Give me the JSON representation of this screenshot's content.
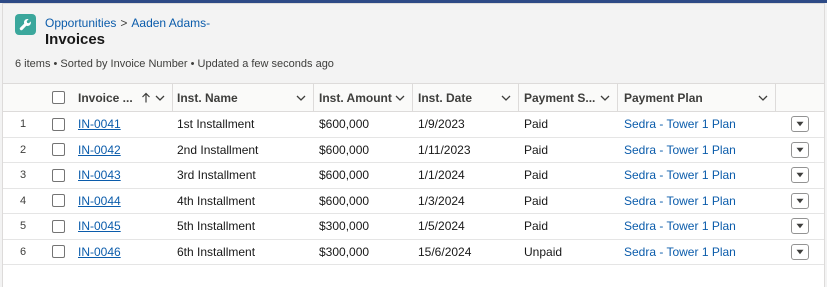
{
  "header": {
    "breadcrumb": [
      "Opportunities",
      "Aaden Adams-"
    ],
    "breadcrumb_separator": ">",
    "title": "Invoices",
    "status": "6 items • Sorted by Invoice Number • Updated a few seconds ago",
    "app_icon": "wrench-icon"
  },
  "table": {
    "columns": [
      {
        "label": "Invoice ...",
        "sorted": "ascending"
      },
      {
        "label": "Inst. Name"
      },
      {
        "label": "Inst. Amount"
      },
      {
        "label": "Inst. Date"
      },
      {
        "label": "Payment S..."
      },
      {
        "label": "Payment Plan"
      }
    ],
    "rows": [
      {
        "num": "1",
        "invoice": "IN-0041",
        "name": "1st Installment",
        "amount": "$600,000",
        "date": "1/9/2023",
        "payment": "Paid",
        "plan": "Sedra - Tower 1 Plan"
      },
      {
        "num": "2",
        "invoice": "IN-0042",
        "name": "2nd Installment",
        "amount": "$600,000",
        "date": "1/11/2023",
        "payment": "Paid",
        "plan": "Sedra - Tower 1 Plan"
      },
      {
        "num": "3",
        "invoice": "IN-0043",
        "name": "3rd Installment",
        "amount": "$600,000",
        "date": "1/1/2024",
        "payment": "Paid",
        "plan": "Sedra - Tower 1 Plan"
      },
      {
        "num": "4",
        "invoice": "IN-0044",
        "name": "4th Installment",
        "amount": "$600,000",
        "date": "1/3/2024",
        "payment": "Paid",
        "plan": "Sedra - Tower 1 Plan"
      },
      {
        "num": "5",
        "invoice": "IN-0045",
        "name": "5th Installment",
        "amount": "$300,000",
        "date": "1/5/2024",
        "payment": "Paid",
        "plan": "Sedra - Tower 1 Plan"
      },
      {
        "num": "6",
        "invoice": "IN-0046",
        "name": "6th Installment",
        "amount": "$300,000",
        "date": "15/6/2024",
        "payment": "Unpaid",
        "plan": "Sedra - Tower 1 Plan"
      }
    ]
  },
  "colors": {
    "accent": "#0b5cab",
    "app_icon_bg": "#3ba79c",
    "top_bar": "#2d4a86"
  }
}
